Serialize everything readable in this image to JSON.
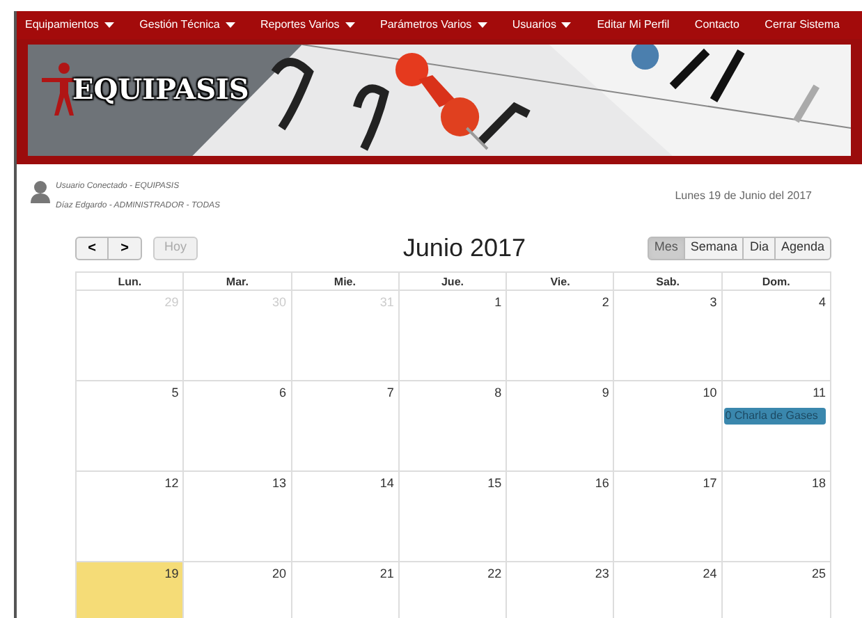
{
  "nav": [
    {
      "label": "Equipamientos",
      "dropdown": true
    },
    {
      "label": "Gestión Técnica",
      "dropdown": true
    },
    {
      "label": "Reportes Varios",
      "dropdown": true
    },
    {
      "label": "Parámetros Varios",
      "dropdown": true
    },
    {
      "label": "Usuarios",
      "dropdown": true
    },
    {
      "label": "Editar Mi Perfil",
      "dropdown": false
    },
    {
      "label": "Contacto",
      "dropdown": false
    },
    {
      "label": "Cerrar Sistema",
      "dropdown": false
    }
  ],
  "banner": {
    "logo": "EQUIPASIS"
  },
  "user": {
    "line1": "Usuario Conectado - EQUIPASIS",
    "line2": "Díaz Edgardo - ADMINISTRADOR - TODAS"
  },
  "date": "Lunes 19 de Junio del 2017",
  "toolbar": {
    "prev": "<",
    "next": ">",
    "today": "Hoy",
    "title": "Junio 2017",
    "views": [
      {
        "label": "Mes",
        "selected": true
      },
      {
        "label": "Semana",
        "selected": false
      },
      {
        "label": "Dia",
        "selected": false
      },
      {
        "label": "Agenda",
        "selected": false
      }
    ]
  },
  "calendar": {
    "weekdays": [
      "Lun.",
      "Mar.",
      "Mie.",
      "Jue.",
      "Vie.",
      "Sab.",
      "Dom."
    ],
    "weeks": [
      [
        {
          "day": "29",
          "other_month": true,
          "today": false
        },
        {
          "day": "30",
          "other_month": true,
          "today": false
        },
        {
          "day": "31",
          "other_month": true,
          "today": false
        },
        {
          "day": "1",
          "other_month": false,
          "today": false
        },
        {
          "day": "2",
          "other_month": false,
          "today": false
        },
        {
          "day": "3",
          "other_month": false,
          "today": false
        },
        {
          "day": "4",
          "other_month": false,
          "today": false
        }
      ],
      [
        {
          "day": "5",
          "other_month": false,
          "today": false
        },
        {
          "day": "6",
          "other_month": false,
          "today": false
        },
        {
          "day": "7",
          "other_month": false,
          "today": false
        },
        {
          "day": "8",
          "other_month": false,
          "today": false
        },
        {
          "day": "9",
          "other_month": false,
          "today": false
        },
        {
          "day": "10",
          "other_month": false,
          "today": false
        },
        {
          "day": "11",
          "other_month": false,
          "today": false,
          "events": [
            "0 Charla de Gases"
          ]
        }
      ],
      [
        {
          "day": "12",
          "other_month": false,
          "today": false
        },
        {
          "day": "13",
          "other_month": false,
          "today": false
        },
        {
          "day": "14",
          "other_month": false,
          "today": false
        },
        {
          "day": "15",
          "other_month": false,
          "today": false
        },
        {
          "day": "16",
          "other_month": false,
          "today": false
        },
        {
          "day": "17",
          "other_month": false,
          "today": false
        },
        {
          "day": "18",
          "other_month": false,
          "today": false
        }
      ],
      [
        {
          "day": "19",
          "other_month": false,
          "today": true
        },
        {
          "day": "20",
          "other_month": false,
          "today": false
        },
        {
          "day": "21",
          "other_month": false,
          "today": false
        },
        {
          "day": "22",
          "other_month": false,
          "today": false
        },
        {
          "day": "23",
          "other_month": false,
          "today": false
        },
        {
          "day": "24",
          "other_month": false,
          "today": false
        },
        {
          "day": "25",
          "other_month": false,
          "today": false
        }
      ]
    ]
  }
}
